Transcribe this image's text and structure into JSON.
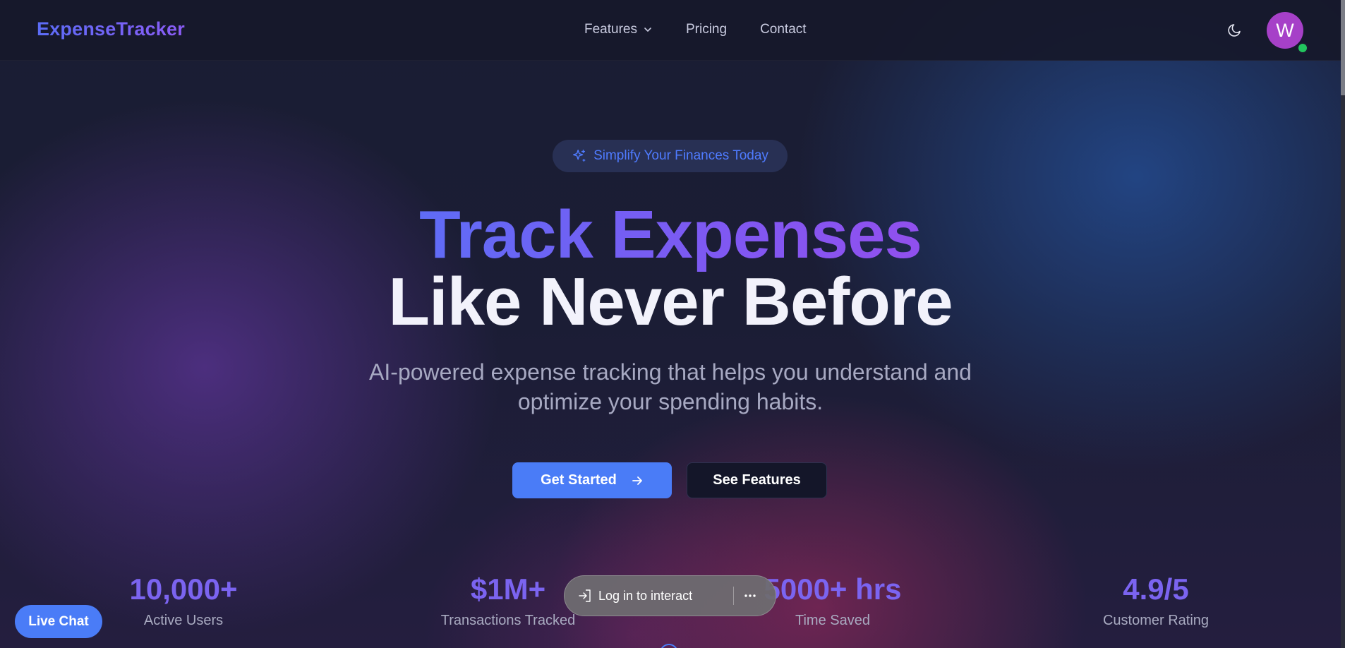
{
  "navbar": {
    "brand": "ExpenseTracker",
    "links": [
      {
        "label": "Features",
        "has_dropdown": true,
        "icon": "chevron-down-icon"
      },
      {
        "label": "Pricing"
      },
      {
        "label": "Contact"
      }
    ],
    "theme_toggle_icon": "moon-icon",
    "avatar_initial": "W",
    "avatar_color": "#a640c8",
    "online_status_color": "#22c55e"
  },
  "hero": {
    "badge_icon": "sparkles-icon",
    "badge_text": "Simplify Your Finances Today",
    "title_line1": "Track Expenses",
    "title_line2": "Like Never Before",
    "subtitle": "AI-powered expense tracking that helps you understand and optimize your spending habits.",
    "primary_button": "Get Started",
    "primary_button_icon": "arrow-right-icon",
    "secondary_button": "See Features"
  },
  "stats": [
    {
      "value": "10,000+",
      "label": "Active Users"
    },
    {
      "value": "$1M+",
      "label": "Transactions Tracked"
    },
    {
      "value": "5000+ hrs",
      "label": "Time Saved"
    },
    {
      "value": "4.9/5",
      "label": "Customer Rating"
    }
  ],
  "live_chat": {
    "label": "Live Chat"
  },
  "login_overlay": {
    "icon": "sign-in-icon",
    "label": "Log in to interact",
    "more_icon": "more-horizontal-icon"
  },
  "colors": {
    "accent_blue": "#4a7cf7",
    "accent_purple": "#7b64f0",
    "background": "#1a1d33"
  }
}
